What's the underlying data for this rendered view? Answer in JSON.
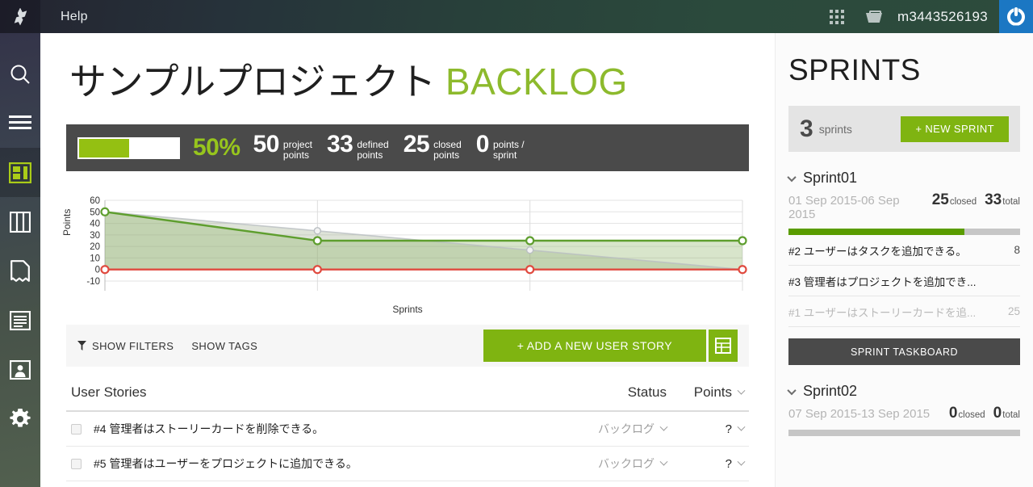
{
  "topbar": {
    "logo_icon": "taiga-star-logo",
    "help_label": "Help",
    "grid_icon": "apps-grid-icon",
    "basket_icon": "basket-icon",
    "username": "m3443526193",
    "power_icon": "power-logout-icon"
  },
  "sidebar": {
    "items": [
      {
        "name": "search",
        "icon": "search-icon",
        "active": false
      },
      {
        "name": "backlog-menu",
        "icon": "hamburger-menu-icon",
        "active": false
      },
      {
        "name": "backlog",
        "icon": "backlog-icon",
        "active": true
      },
      {
        "name": "kanban",
        "icon": "kanban-columns-icon",
        "active": false
      },
      {
        "name": "issues",
        "icon": "issues-document-icon",
        "active": false
      },
      {
        "name": "wiki",
        "icon": "wiki-lines-icon",
        "active": false
      },
      {
        "name": "team",
        "icon": "team-person-icon",
        "active": false
      },
      {
        "name": "settings",
        "icon": "gear-icon",
        "active": false
      }
    ]
  },
  "main": {
    "project_name": "サンプルプロジェクト",
    "section_label": "BACKLOG",
    "accent_color": "#8dba2d",
    "stats": {
      "progress_percent": 50,
      "percent_label": "50%",
      "items": [
        {
          "num": "50",
          "line1": "project",
          "line2": "points"
        },
        {
          "num": "33",
          "line1": "defined",
          "line2": "points"
        },
        {
          "num": "25",
          "line1": "closed",
          "line2": "points"
        },
        {
          "num": "0",
          "line1": "points /",
          "line2": "sprint"
        }
      ]
    },
    "toolbar": {
      "show_filters_label": "SHOW FILTERS",
      "show_tags_label": "SHOW TAGS",
      "add_story_label": "+ ADD A NEW USER STORY",
      "table_icon": "spreadsheet-icon",
      "funnel_icon": "funnel-filter-icon"
    },
    "stories_table": {
      "col_title": "User Stories",
      "col_status": "Status",
      "col_points": "Points",
      "rows": [
        {
          "id": "#4",
          "title": "管理者はストーリーカードを削除できる。",
          "status": "バックログ",
          "points": "?"
        },
        {
          "id": "#5",
          "title": "管理者はユーザーをプロジェクトに追加できる。",
          "status": "バックログ",
          "points": "?"
        }
      ]
    }
  },
  "chart_data": {
    "type": "line",
    "title": "",
    "xlabel": "Sprints",
    "ylabel": "Points",
    "ylim": [
      -10,
      60
    ],
    "yticks": [
      60,
      50,
      40,
      30,
      20,
      10,
      0,
      -10
    ],
    "x": [
      0,
      1,
      2,
      3
    ],
    "grid": true,
    "legend": "none",
    "series": [
      {
        "name": "ideal",
        "color": "#b9bec2",
        "values": [
          50,
          33.5,
          16.8,
          0
        ]
      },
      {
        "name": "pending points",
        "color": "#5e9e2e",
        "values": [
          50,
          25,
          25,
          25
        ]
      },
      {
        "name": "optional points",
        "color": "#e04a3f",
        "values": [
          0,
          0,
          0,
          0
        ]
      }
    ]
  },
  "sprints_panel": {
    "title": "SPRINTS",
    "count": "3",
    "count_label": "sprints",
    "new_sprint_label": "+ NEW SPRINT",
    "taskboard_label": "SPRINT TASKBOARD",
    "sprints": [
      {
        "name": "Sprint01",
        "dates": "01 Sep 2015-06 Sep 2015",
        "closed": "25",
        "closed_label": "closed",
        "total": "33",
        "total_label": "total",
        "progress_percent": 76,
        "stories": [
          {
            "id": "#2",
            "title": "ユーザーはタスクを追加できる。",
            "points": "8",
            "closed": false
          },
          {
            "id": "#3",
            "title": "管理者はプロジェクトを追加でき...",
            "points": "",
            "closed": false
          },
          {
            "id": "#1",
            "title": "ユーザーはストーリーカードを追...",
            "points": "25",
            "closed": true
          }
        ]
      },
      {
        "name": "Sprint02",
        "dates": "07 Sep 2015-13 Sep 2015",
        "closed": "0",
        "closed_label": "closed",
        "total": "0",
        "total_label": "total",
        "progress_percent": 0,
        "stories": []
      }
    ]
  }
}
